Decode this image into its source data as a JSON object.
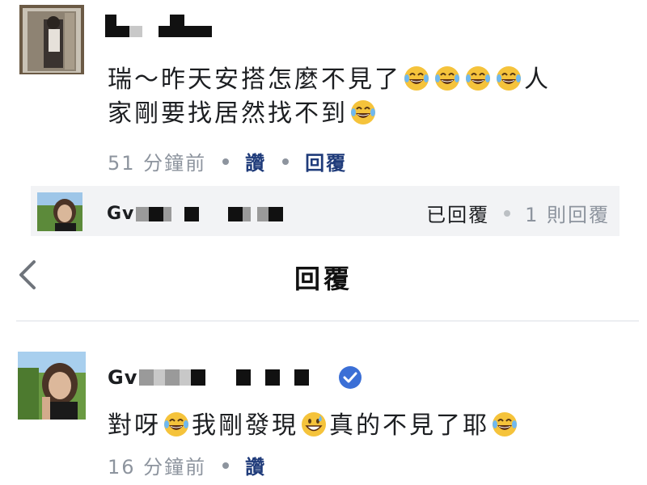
{
  "comment": {
    "line1": "瑞～昨天安搭怎麼不見了",
    "line1_tail": "人",
    "line2": "家剛要找居然找不到",
    "time": "51 分鐘前",
    "like": "讚",
    "reply": "回覆"
  },
  "reply_bar": {
    "name_prefix": "Gv",
    "replied": "已回覆",
    "count": "1 則回覆"
  },
  "header": {
    "title": "回覆",
    "back_icon": "chevron-left-icon"
  },
  "reply_comment": {
    "name_prefix": "Gv",
    "verified_icon": "verified-badge-icon",
    "text_part1": "對呀",
    "text_part2": "我剛發現",
    "text_part3": "真的不見了耶",
    "time": "16 分鐘前",
    "like": "讚"
  },
  "colors": {
    "link": "#1f3b7a",
    "meta": "#8d949e",
    "verified": "#3b6fd6",
    "reply_bar_bg": "#f2f3f5"
  }
}
